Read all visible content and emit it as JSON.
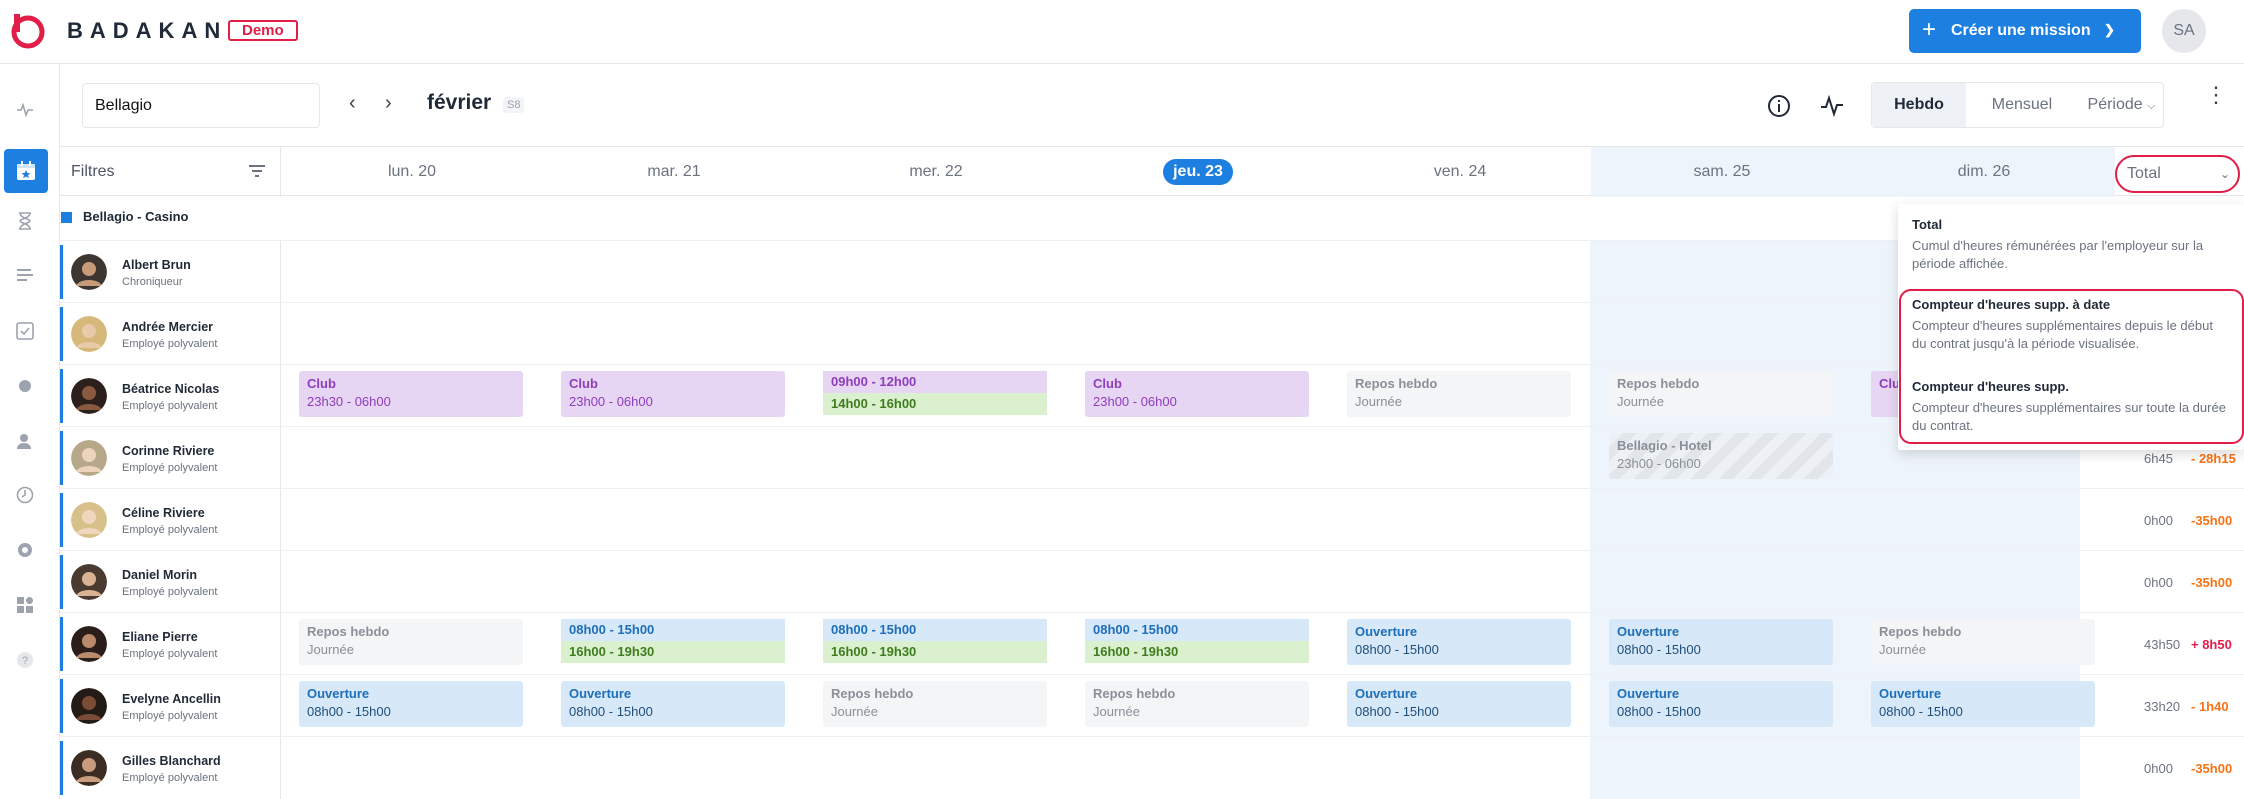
{
  "brand": {
    "name": "BADAKAN",
    "badge": "Demo"
  },
  "header": {
    "create_label": "Créer une mission",
    "user_initials": "SA"
  },
  "sidebar": {
    "icons": [
      "activity-icon",
      "calendar-icon",
      "hourglass-icon",
      "list-icon",
      "checklist-icon",
      "dot-icon",
      "user-icon",
      "clock-icon",
      "settings-icon",
      "apps-icon",
      "help-icon"
    ]
  },
  "toolbar": {
    "location_value": "Bellagio",
    "month": "février",
    "week": "S8"
  },
  "views": {
    "hebdo": "Hebdo",
    "mensuel": "Mensuel",
    "periode": "Période"
  },
  "grid": {
    "filters_label": "Filtres",
    "days": [
      "lun.  20",
      "mar.  21",
      "mer.  22",
      "jeu. 23",
      "ven.  24",
      "sam.  25",
      "dim.  26"
    ],
    "total_select": "Total",
    "group_label": "Bellagio - Casino"
  },
  "employees": [
    {
      "name": "Albert Brun",
      "role": "Chroniqueur",
      "total": "",
      "counter": ""
    },
    {
      "name": "Andrée Mercier",
      "role": "Employé polyvalent",
      "total": "",
      "counter": ""
    },
    {
      "name": "Béatrice Nicolas",
      "role": "Employé polyvalent",
      "total": "",
      "counter": ""
    },
    {
      "name": "Corinne Riviere",
      "role": "Employé polyvalent",
      "total": "6h45",
      "counter": "- 28h15"
    },
    {
      "name": "Céline Riviere",
      "role": "Employé polyvalent",
      "total": "0h00",
      "counter": "-35h00"
    },
    {
      "name": "Daniel Morin",
      "role": "Employé polyvalent",
      "total": "0h00",
      "counter": "-35h00"
    },
    {
      "name": "Eliane Pierre",
      "role": "Employé polyvalent",
      "total": "43h50",
      "counter": "+ 8h50"
    },
    {
      "name": "Evelyne Ancellin",
      "role": "Employé polyvalent",
      "total": "33h20",
      "counter": "- 1h40"
    },
    {
      "name": "Gilles Blanchard",
      "role": "Employé polyvalent",
      "total": "0h00",
      "counter": "-35h00"
    }
  ],
  "shifts": {
    "beatrice": [
      {
        "t": "Club",
        "s": "23h30 - 06h00"
      },
      {
        "t": "Club",
        "s": "23h00 - 06h00"
      },
      {
        "t": "09h00 - 12h00",
        "s": "14h00 - 16h00"
      },
      {
        "t": "Club",
        "s": "23h00 - 06h00"
      },
      {
        "t": "Repos hebdo",
        "s": "Journée"
      },
      {
        "t": "Repos hebdo",
        "s": "Journée"
      },
      {
        "t": "Clu",
        "s": ""
      }
    ],
    "corinne": {
      "t": "Bellagio - Hotel",
      "s": "23h00 - 06h00"
    },
    "eliane": [
      {
        "t": "Repos hebdo",
        "s": "Journée"
      },
      {
        "t": "08h00 - 15h00",
        "s": "16h00 - 19h30"
      },
      {
        "t": "08h00 - 15h00",
        "s": "16h00 - 19h30"
      },
      {
        "t": "08h00 - 15h00",
        "s": "16h00 - 19h30"
      },
      {
        "t": "Ouverture",
        "s": "08h00 - 15h00"
      },
      {
        "t": "Ouverture",
        "s": "08h00 - 15h00"
      },
      {
        "t": "Repos hebdo",
        "s": "Journée"
      }
    ],
    "evelyne": [
      {
        "t": "Ouverture",
        "s": "08h00 - 15h00"
      },
      {
        "t": "Ouverture",
        "s": "08h00 - 15h00"
      },
      {
        "t": "Repos hebdo",
        "s": "Journée"
      },
      {
        "t": "Repos hebdo",
        "s": "Journée"
      },
      {
        "t": "Ouverture",
        "s": "08h00 - 15h00"
      },
      {
        "t": "Ouverture",
        "s": "08h00 - 15h00"
      },
      {
        "t": "Ouverture",
        "s": "08h00 - 15h00"
      }
    ]
  },
  "dropdown": [
    {
      "title": "Total",
      "desc": "Cumul d'heures rémunérées par l'employeur sur la période affichée."
    },
    {
      "title": "Compteur d'heures supp. à date",
      "desc": "Compteur d'heures supplémentaires depuis le début du contrat jusqu'à la période visualisée."
    },
    {
      "title": "Compteur d'heures supp.",
      "desc": "Compteur d'heures supplémentaires sur toute la durée du contrat."
    }
  ],
  "colors": {
    "accent": "#1d7fe0",
    "danger": "#e11d48",
    "negative": "#f97316",
    "positive": "#e11d48"
  }
}
